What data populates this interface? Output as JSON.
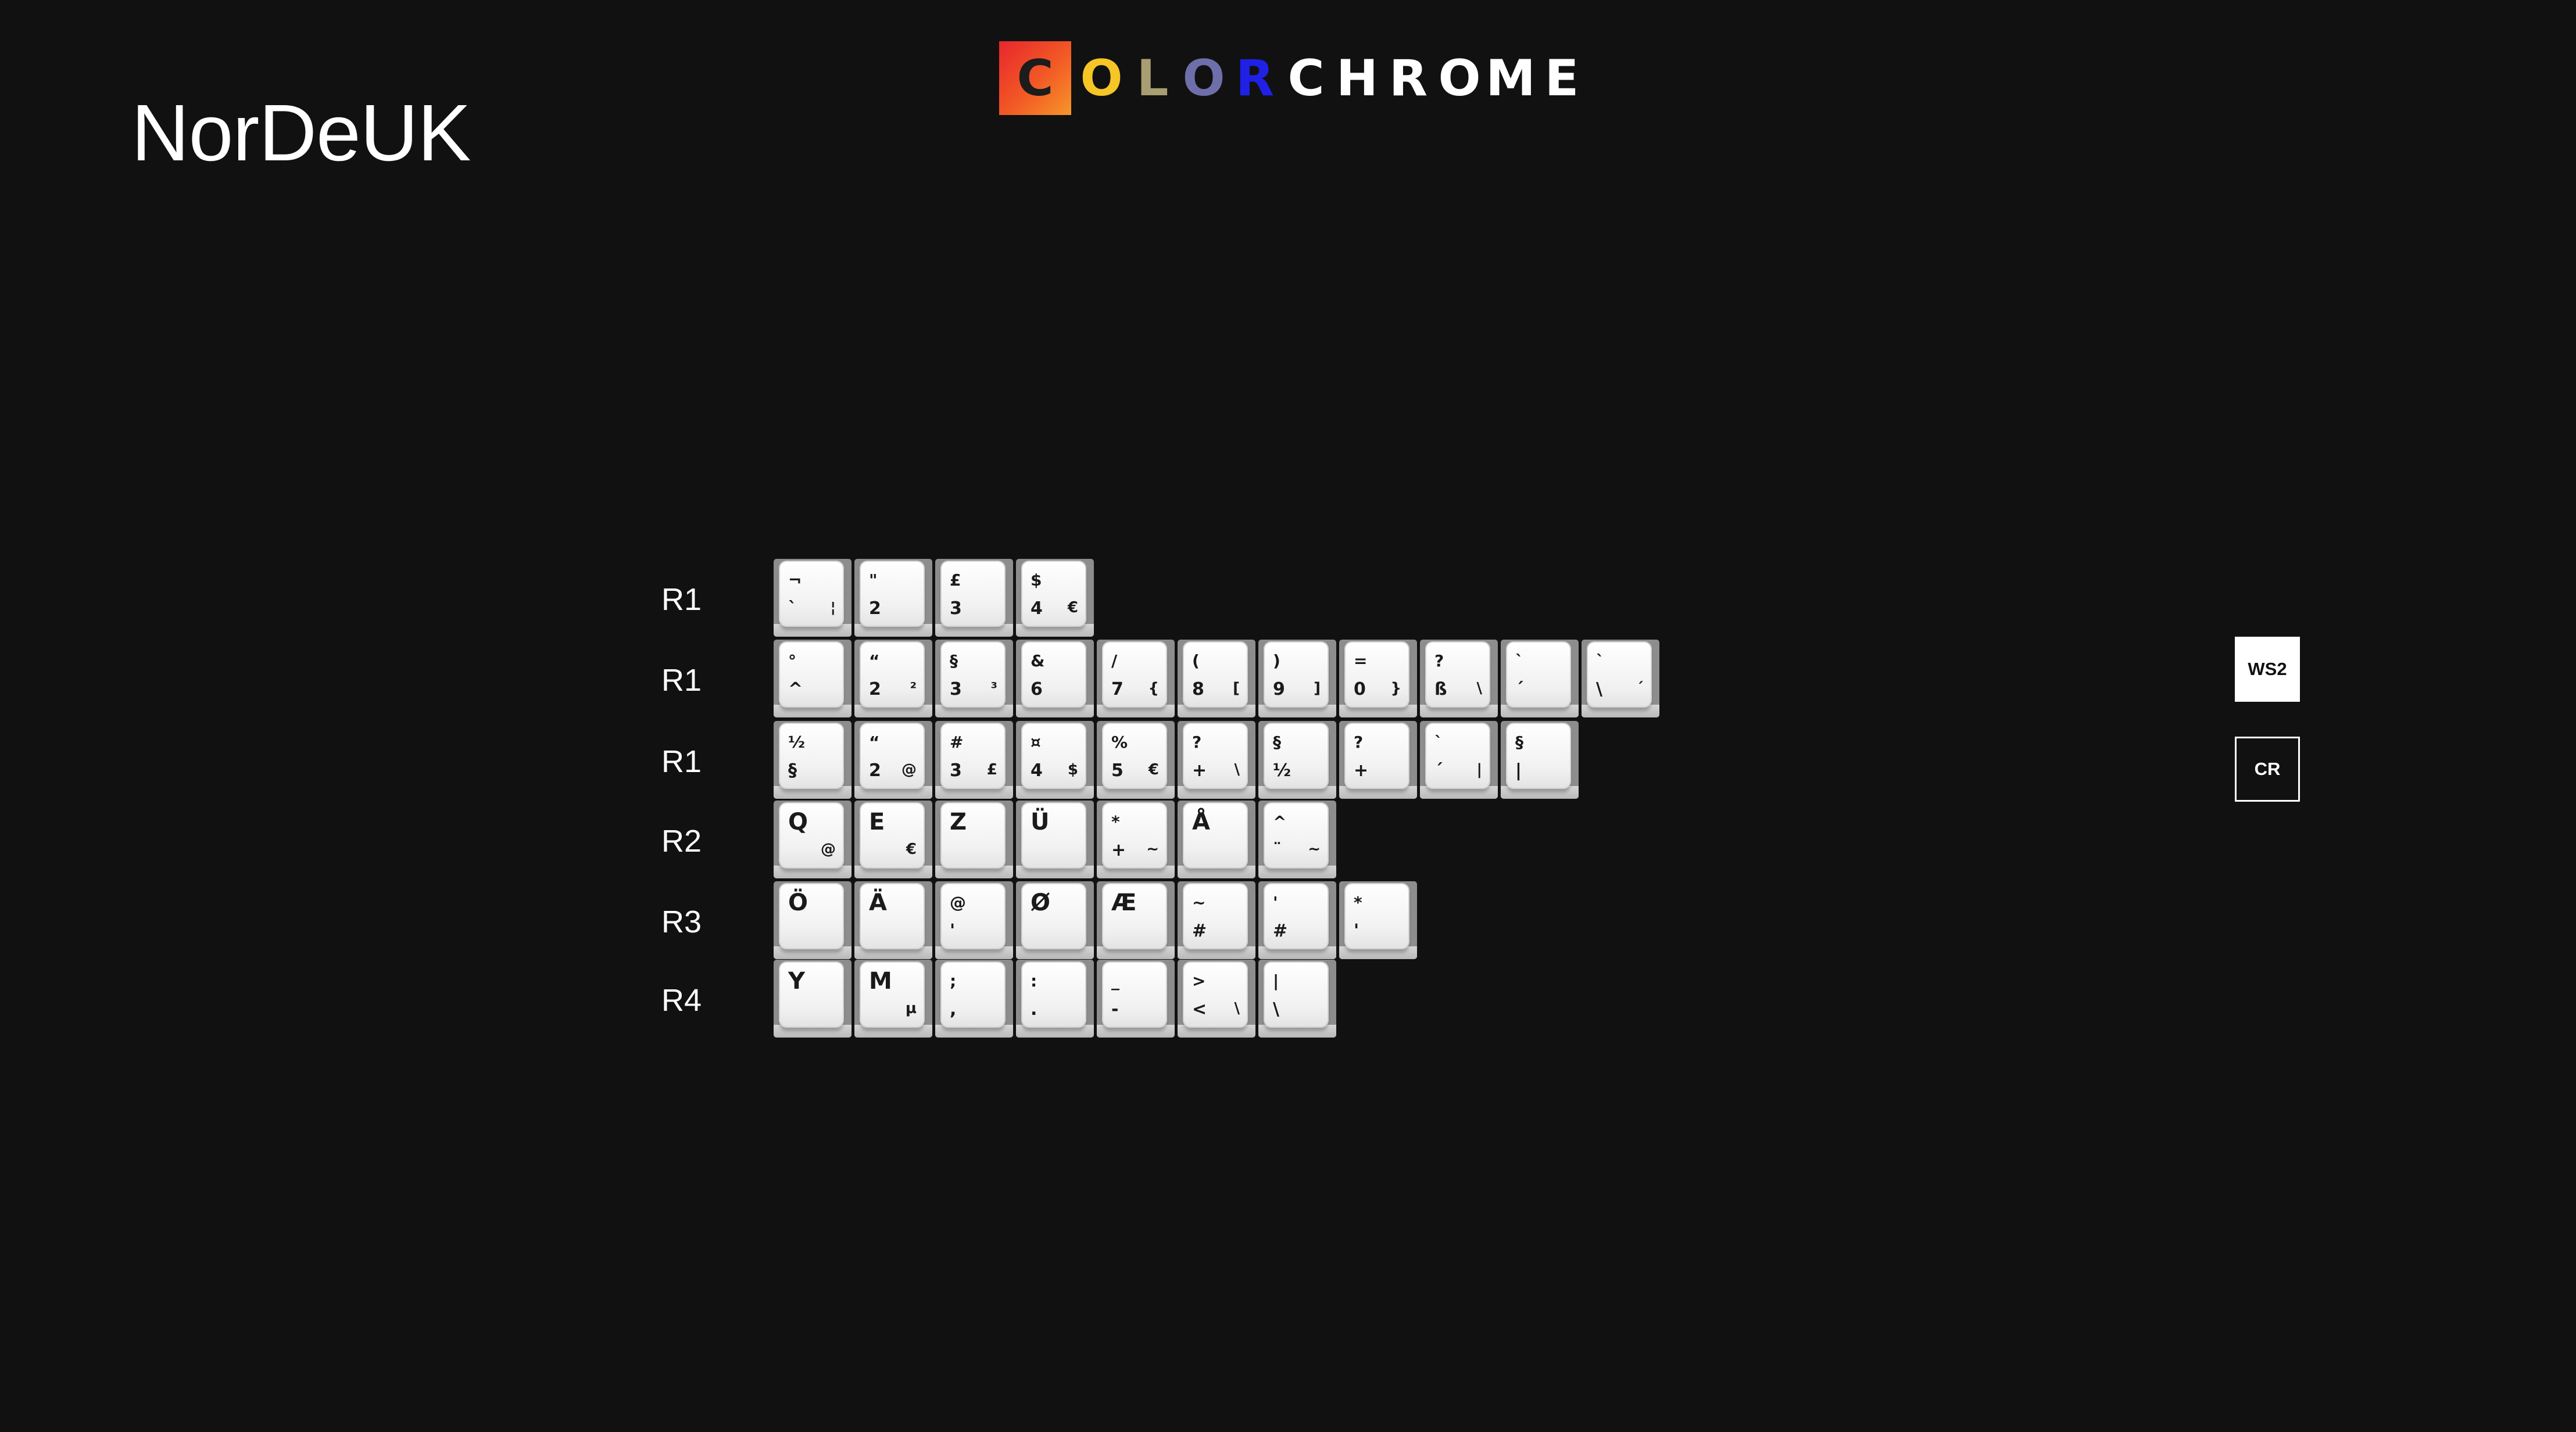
{
  "title": "NorDeUK",
  "logo": {
    "box_letter": "C",
    "letters": [
      "O",
      "L",
      "O",
      "R",
      "C",
      "H",
      "R",
      "O",
      "M",
      "E"
    ],
    "letter_colors": [
      "#f6c526",
      "#a99d72",
      "#6e6faa",
      "#2020e6",
      "#ffffff",
      "#ffffff",
      "#ffffff",
      "#ffffff",
      "#ffffff",
      "#ffffff"
    ]
  },
  "rows": [
    {
      "label": "R1",
      "keys": [
        {
          "tl": "¬",
          "bl": "`",
          "br": "¦"
        },
        {
          "tl": "\"",
          "bl": "2",
          "br": ""
        },
        {
          "tl": "£",
          "bl": "3",
          "br": ""
        },
        {
          "tl": "$",
          "bl": "4",
          "br": "€"
        }
      ]
    },
    {
      "label": "R1",
      "keys": [
        {
          "tl": "°",
          "bl": "^",
          "br": ""
        },
        {
          "tl": "“",
          "bl": "2",
          "br": "²"
        },
        {
          "tl": "§",
          "bl": "3",
          "br": "³"
        },
        {
          "tl": "&",
          "bl": "6",
          "br": ""
        },
        {
          "tl": "/",
          "bl": "7",
          "br": "{"
        },
        {
          "tl": "(",
          "bl": "8",
          "br": "["
        },
        {
          "tl": ")",
          "bl": "9",
          "br": "]"
        },
        {
          "tl": "=",
          "bl": "0",
          "br": "}"
        },
        {
          "tl": "?",
          "bl": "ß",
          "br": "\\"
        },
        {
          "tl": "`",
          "bl": "´",
          "br": ""
        },
        {
          "tl": "`",
          "bl": "\\",
          "br": "´"
        }
      ]
    },
    {
      "label": "R1",
      "keys": [
        {
          "tl": "½",
          "bl": "§",
          "br": ""
        },
        {
          "tl": "“",
          "bl": "2",
          "br": "@"
        },
        {
          "tl": "#",
          "bl": "3",
          "br": "£"
        },
        {
          "tl": "¤",
          "bl": "4",
          "br": "$"
        },
        {
          "tl": "%",
          "bl": "5",
          "br": "€"
        },
        {
          "tl": "?",
          "bl": "+",
          "br": "\\"
        },
        {
          "tl": "§",
          "bl": "½",
          "br": ""
        },
        {
          "tl": "?",
          "bl": "+",
          "br": ""
        },
        {
          "tl": "`",
          "bl": "´",
          "br": "|"
        },
        {
          "tl": "§",
          "bl": "|",
          "br": ""
        }
      ]
    },
    {
      "label": "R2",
      "keys": [
        {
          "tl": "Q",
          "bl": "",
          "br": "@"
        },
        {
          "tl": "E",
          "bl": "",
          "br": "€"
        },
        {
          "tl": "Z",
          "bl": "",
          "br": ""
        },
        {
          "tl": "Ü",
          "bl": "",
          "br": ""
        },
        {
          "tl": "*",
          "bl": "+",
          "br": "~"
        },
        {
          "tl": "Å",
          "bl": "",
          "br": ""
        },
        {
          "tl": "^",
          "bl": "¨",
          "br": "~"
        }
      ]
    },
    {
      "label": "R3",
      "keys": [
        {
          "tl": "Ö",
          "bl": "",
          "br": ""
        },
        {
          "tl": "Ä",
          "bl": "",
          "br": ""
        },
        {
          "tl": "@",
          "bl": "'",
          "br": ""
        },
        {
          "tl": "Ø",
          "bl": "",
          "br": ""
        },
        {
          "tl": "Æ",
          "bl": "",
          "br": ""
        },
        {
          "tl": "~",
          "bl": "#",
          "br": ""
        },
        {
          "tl": "'",
          "bl": "#",
          "br": ""
        },
        {
          "tl": "*",
          "bl": "'",
          "br": ""
        }
      ]
    },
    {
      "label": "R4",
      "keys": [
        {
          "tl": "Y",
          "bl": "",
          "br": ""
        },
        {
          "tl": "M",
          "bl": "",
          "br": "µ"
        },
        {
          "tl": ";",
          "bl": ",",
          "br": ""
        },
        {
          "tl": ":",
          "bl": ".",
          "br": ""
        },
        {
          "tl": "_",
          "bl": "-",
          "br": ""
        },
        {
          "tl": ">",
          "bl": "<",
          "br": "\\"
        },
        {
          "tl": "|",
          "bl": "\\",
          "br": ""
        }
      ]
    }
  ],
  "badges": {
    "ws2": "WS2",
    "cr": "CR"
  }
}
